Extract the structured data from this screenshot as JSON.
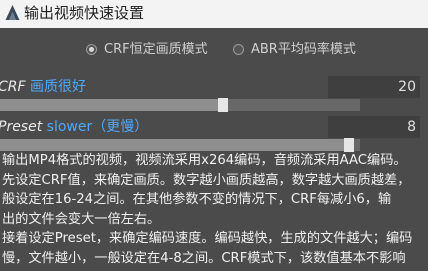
{
  "window": {
    "title": "输出视频快速设置",
    "logo_icon": "app-logo-icon"
  },
  "mode": {
    "options": [
      {
        "label": "CRF恒定画质模式",
        "selected": true
      },
      {
        "label": "ABR平均码率模式",
        "selected": false
      }
    ]
  },
  "crf": {
    "label_prefix": "CRF ",
    "label_quality": "画质很好",
    "value": "20",
    "slider_fraction": 0.62
  },
  "preset": {
    "label_prefix": "Preset ",
    "label_speed": "slower（更慢）",
    "value": "8",
    "slider_fraction": 0.97
  },
  "description": {
    "lines": [
      "输出MP4格式的视频，视频流采用x264编码，音频流采用AAC编码。",
      "先设定CRF值，来确定画质。数字越小画质越高，数字越大画质越差，",
      "般设定在16-24之间。在其他参数不变的情况下，CRF每减小6，输",
      "出的文件会变大一倍左右。",
      "接着设定Preset，来确定编码速度。编码越快，生成的文件越大；编码",
      "慢，文件越小，一般设定在4-8之间。CRF模式下，该数值基本不影响"
    ]
  },
  "colors": {
    "accent": "#4fa8ff",
    "background": "#4b4b4b",
    "titlebar": "#f3f3f3"
  }
}
